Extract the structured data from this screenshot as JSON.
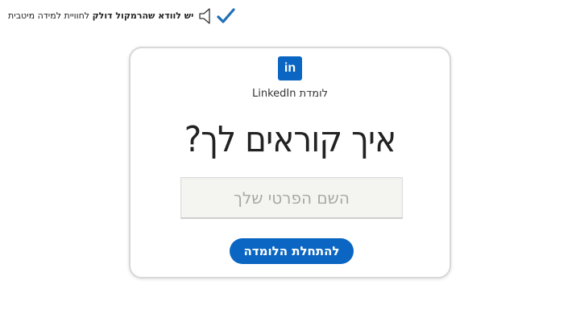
{
  "notice": {
    "text_regular": "לחוויית למידה מיטבית",
    "text_bold": "יש לוודא שהרמקול דולק",
    "speaker_icon": "speaker-icon",
    "check_icon": "check-icon"
  },
  "card": {
    "logo_text": "in",
    "brand_label": "לומדת LinkedIn",
    "headline": "איך קוראים לך?",
    "name_input": {
      "value": "",
      "placeholder": "השם הפרטי שלך"
    },
    "start_button_label": "להתחלת הלומדה"
  },
  "colors": {
    "accent": "#0a66c2",
    "check": "#1f6fb7",
    "card_border": "#d8d8d8",
    "input_bg": "#f4f4f0"
  }
}
